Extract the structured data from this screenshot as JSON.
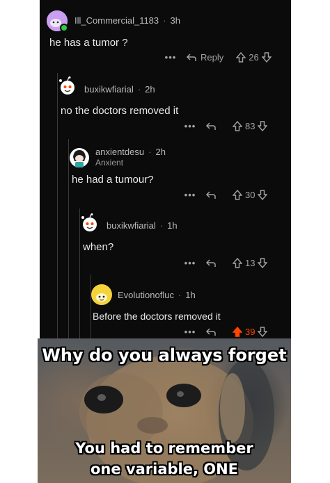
{
  "comments": [
    {
      "username": "Ill_Commercial_1183",
      "sep": "·",
      "age": "3h",
      "flair": "",
      "text": "he has a tumor ?",
      "more": "•••",
      "reply_label": "Reply",
      "score": "26",
      "upvoted": false
    },
    {
      "username": "buxikwfiarial",
      "sep": "·",
      "age": "2h",
      "flair": "",
      "text": "no the doctors removed it",
      "more": "•••",
      "reply_label": "",
      "score": "83",
      "upvoted": false
    },
    {
      "username": "anxientdesu",
      "sep": "·",
      "age": "2h",
      "flair": "Anxient",
      "text": "he had a tumour?",
      "more": "•••",
      "reply_label": "",
      "score": "30",
      "upvoted": false
    },
    {
      "username": "buxikwfiarial",
      "sep": "·",
      "age": "1h",
      "flair": "",
      "text": "when?",
      "more": "•••",
      "reply_label": "",
      "score": "13",
      "upvoted": false
    },
    {
      "username": "Evolutionofluc",
      "sep": "·",
      "age": "1h",
      "flair": "",
      "text": "Before the doctors removed it",
      "more": "•••",
      "reply_label": "",
      "score": "39",
      "upvoted": true
    }
  ],
  "meme": {
    "top_text": "Why do you always forget",
    "bottom_line1": "You had to remember",
    "bottom_line2": "one variable, ONE"
  },
  "colors": {
    "background": "#0b0b0b",
    "upvote_active": "#ff4500",
    "avatar_purple": "#c9a0f0",
    "avatar_yellow": "#f5d33a"
  },
  "icons": [
    "reddit-snoo-avatar-icon",
    "reply-arrow-icon",
    "upvote-arrow-icon",
    "downvote-arrow-icon",
    "more-options-icon"
  ]
}
